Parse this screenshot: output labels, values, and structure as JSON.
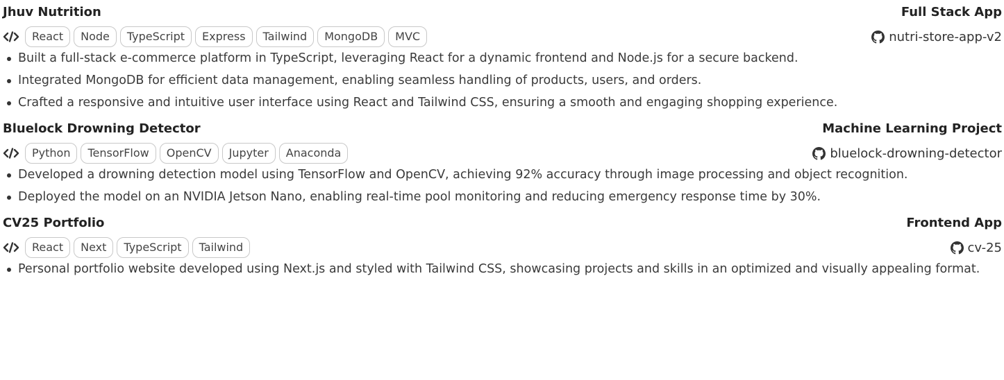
{
  "projects": [
    {
      "name": "Jhuv Nutrition",
      "type": "Full Stack App",
      "tags": [
        "React",
        "Node",
        "TypeScript",
        "Express",
        "Tailwind",
        "MongoDB",
        "MVC"
      ],
      "repo": "nutri-store-app-v2",
      "bullets": [
        "Built a full-stack e-commerce platform in TypeScript, leveraging React for a dynamic frontend and Node.js for a secure backend.",
        "Integrated MongoDB for efficient data management, enabling seamless handling of products, users, and orders.",
        "Crafted a responsive and intuitive user interface using React and Tailwind CSS, ensuring a smooth and engaging shopping experience."
      ]
    },
    {
      "name": "Bluelock Drowning Detector",
      "type": "Machine Learning Project",
      "tags": [
        "Python",
        "TensorFlow",
        "OpenCV",
        "Jupyter",
        "Anaconda"
      ],
      "repo": "bluelock-drowning-detector",
      "bullets": [
        "Developed a drowning detection model using TensorFlow and OpenCV, achieving 92% accuracy through image processing and object recognition.",
        "Deployed the model on an NVIDIA Jetson Nano, enabling real-time pool monitoring and reducing emergency response time by 30%."
      ]
    },
    {
      "name": "CV25 Portfolio",
      "type": "Frontend App",
      "tags": [
        "React",
        "Next",
        "TypeScript",
        "Tailwind"
      ],
      "repo": "cv-25",
      "bullets": [
        "Personal portfolio website developed using Next.js and styled with Tailwind CSS, showcasing projects and skills in an optimized and visually appealing format."
      ]
    }
  ],
  "icons": {
    "tech": "code-icon",
    "repo": "github-icon"
  }
}
